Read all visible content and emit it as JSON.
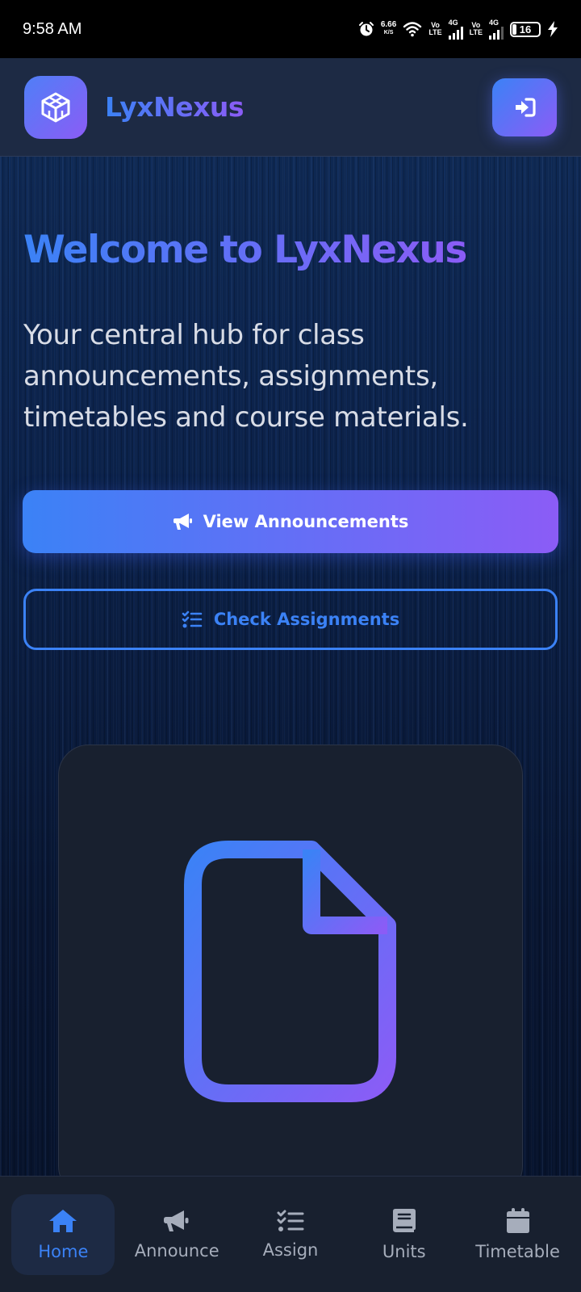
{
  "status_bar": {
    "time": "9:58 AM",
    "speed_value": "6.66",
    "speed_unit": "K/S",
    "sim1_tag_top": "Vo",
    "sim1_tag_bottom": "LTE",
    "sim1_network": "4G",
    "sim2_tag_top": "Vo",
    "sim2_tag_bottom": "LTE",
    "sim2_network": "4G",
    "battery_level": "16",
    "battery_fraction": 0.16
  },
  "header": {
    "brand": "LyxNexus",
    "logo_icon": "codepen-cube-icon",
    "login_icon": "sign-in-icon"
  },
  "hero": {
    "title": "Welcome to LyxNexus",
    "subtitle": "Your central hub for class announcements, assignments, timetables and course materials."
  },
  "actions": {
    "primary_label": "View Announcements",
    "primary_icon": "megaphone-icon",
    "secondary_label": "Check Assignments",
    "secondary_icon": "checklist-icon"
  },
  "card": {
    "icon": "file-icon"
  },
  "colors": {
    "accent_blue": "#3b82f6",
    "accent_purple": "#8b5cf6",
    "surface": "#18202f",
    "header_bg": "#1d2a44"
  },
  "bottom_nav": {
    "items": [
      {
        "label": "Home",
        "icon": "home-icon",
        "active": true
      },
      {
        "label": "Announce",
        "icon": "megaphone-icon",
        "active": false
      },
      {
        "label": "Assign",
        "icon": "checklist-icon",
        "active": false
      },
      {
        "label": "Units",
        "icon": "book-icon",
        "active": false
      },
      {
        "label": "Timetable",
        "icon": "calendar-icon",
        "active": false
      }
    ]
  }
}
